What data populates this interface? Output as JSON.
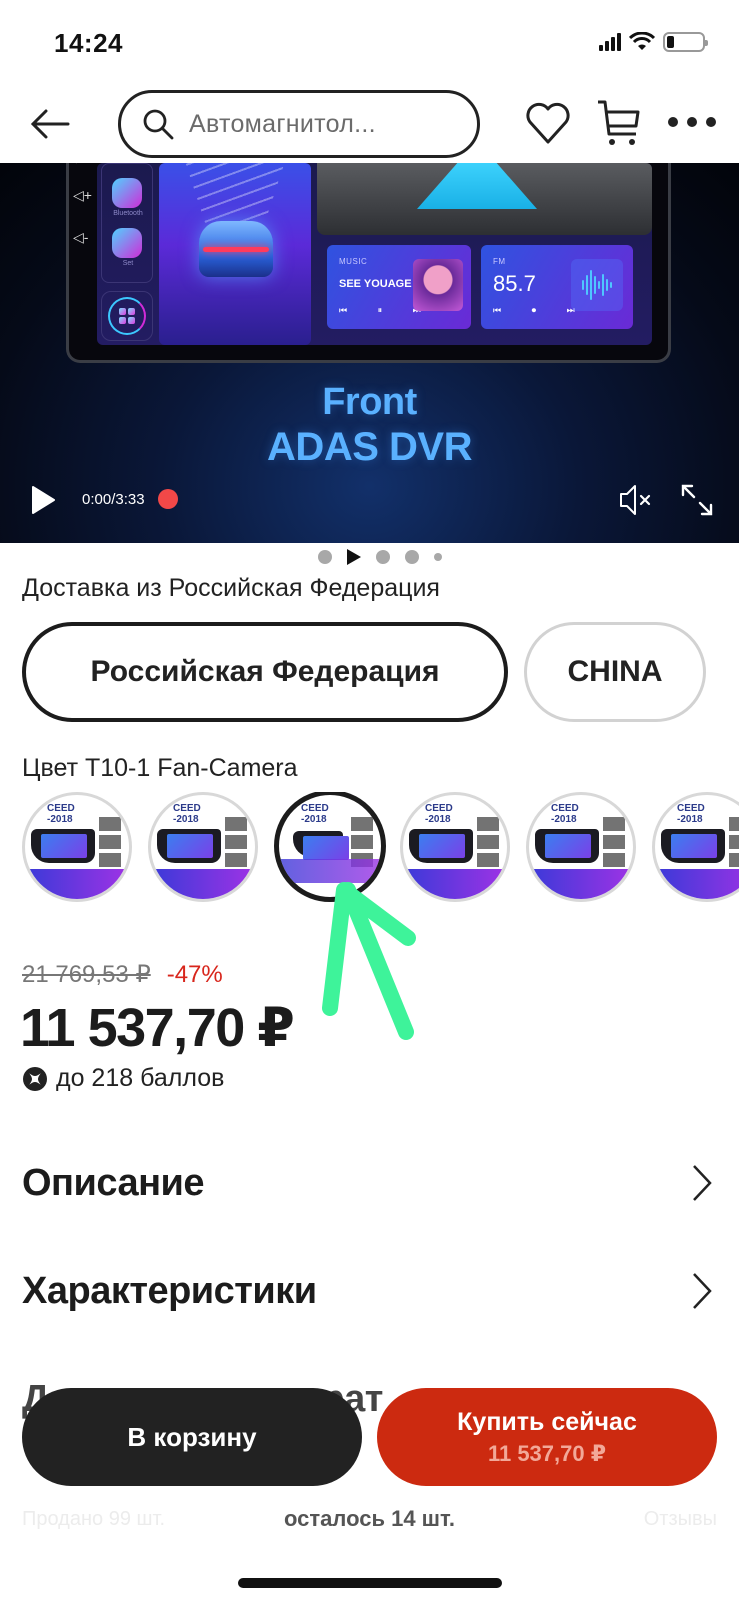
{
  "status_bar": {
    "time": "14:24",
    "battery_level": 0.2
  },
  "top_nav": {
    "back_icon": "arrow-left-icon",
    "search": {
      "icon": "search-icon",
      "value": "Автомагнитол..."
    },
    "favorite_icon": "heart-icon",
    "cart_icon": "cart-icon",
    "more_icon": "more-dots-icon"
  },
  "video": {
    "screen_content": {
      "side_buttons": [
        "Bluetooth",
        "Set"
      ],
      "music_card": {
        "label": "MUSIC",
        "title": "SEE YOUAGE",
        "controls": "⏮ ⏸ ⏭"
      },
      "fm_card": {
        "label": "FM",
        "frequency": "85.7",
        "controls": "⏮ ⏺ ⏭"
      }
    },
    "promo_line1": "Front",
    "promo_line2": "ADAS DVR",
    "time": "0:00/3:33",
    "recording_indicator_color": "#f24848",
    "play_icon": "play-icon",
    "mute_icon": "speaker-muted-icon",
    "fullscreen_icon": "fullscreen-icon"
  },
  "pager": {
    "count": 5,
    "current_index": 1,
    "current_is_video": true
  },
  "delivery": {
    "title": "Доставка из Российская Федерация",
    "options": [
      {
        "label": "Российская Федерация",
        "selected": true
      },
      {
        "label": "CHINA",
        "selected": false
      }
    ]
  },
  "color_variant": {
    "label": "Цвет T10-1 Fan-Camera",
    "thumbnails": [
      {
        "caption": "CEED\n-2018",
        "selected": false
      },
      {
        "caption": "CEED\n-2018",
        "selected": false
      },
      {
        "caption": "CEED\n-2018",
        "selected": true
      },
      {
        "caption": "CEED\n-2018",
        "selected": false
      },
      {
        "caption": "CEED\n-2018",
        "selected": false
      },
      {
        "caption": "CEED\n-2018",
        "selected": false
      }
    ]
  },
  "annotation": {
    "color": "#3ef39a",
    "points_to": "selected color thumbnail"
  },
  "pricing": {
    "old_price": "21 769,53 ₽",
    "discount": "-47%",
    "price": "11 537,70 ₽",
    "points": "до 218 баллов",
    "discount_color": "#d8261c"
  },
  "sections": [
    {
      "title": "Описание"
    },
    {
      "title": "Характеристики"
    },
    {
      "title": "Доставка и возврат"
    }
  ],
  "actions": {
    "add_to_cart": "В корзину",
    "buy_now": "Купить сейчас",
    "buy_now_price": "11 537,70 ₽",
    "stock_left": "осталось 14 шт.",
    "buy_color": "#cc2a10",
    "faded_left": "Продано 99 шт.",
    "faded_right": "Отзывы"
  }
}
